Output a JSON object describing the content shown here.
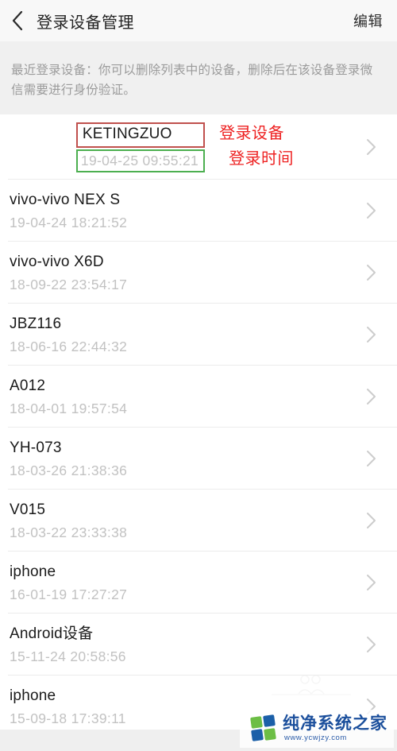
{
  "header": {
    "back_icon": "chevron-left-icon",
    "title": "登录设备管理",
    "action_label": "编辑"
  },
  "description": {
    "text": "最近登录设备：你可以删除列表中的设备，删除后在该设备登录微信需要进行身份验证。"
  },
  "annotations": {
    "device_label": "登录设备",
    "time_label": "登录时间",
    "device_box_color": "#c0504d",
    "time_box_color": "#4caf50",
    "label_color": "#ee2222"
  },
  "devices": [
    {
      "name": "KETINGZUO",
      "time": "19-04-25 09:55:21",
      "annotated": true
    },
    {
      "name": "vivo-vivo NEX S",
      "time": "19-04-24 18:21:52",
      "annotated": false
    },
    {
      "name": "vivo-vivo X6D",
      "time": "18-09-22 23:54:17",
      "annotated": false
    },
    {
      "name": "JBZ116",
      "time": "18-06-16 22:44:32",
      "annotated": false
    },
    {
      "name": "A012",
      "time": "18-04-01 19:57:54",
      "annotated": false
    },
    {
      "name": "YH-073",
      "time": "18-03-26 21:38:36",
      "annotated": false
    },
    {
      "name": "V015",
      "time": "18-03-22 23:33:38",
      "annotated": false
    },
    {
      "name": "iphone",
      "time": "16-01-19 17:27:27",
      "annotated": false
    },
    {
      "name": "Android设备",
      "time": "15-11-24 20:58:56",
      "annotated": false
    },
    {
      "name": "iphone",
      "time": "15-09-18 17:39:11",
      "annotated": false
    }
  ],
  "watermark": {
    "title": "纯净系统之家",
    "url": "www.ycwjzy.com"
  }
}
